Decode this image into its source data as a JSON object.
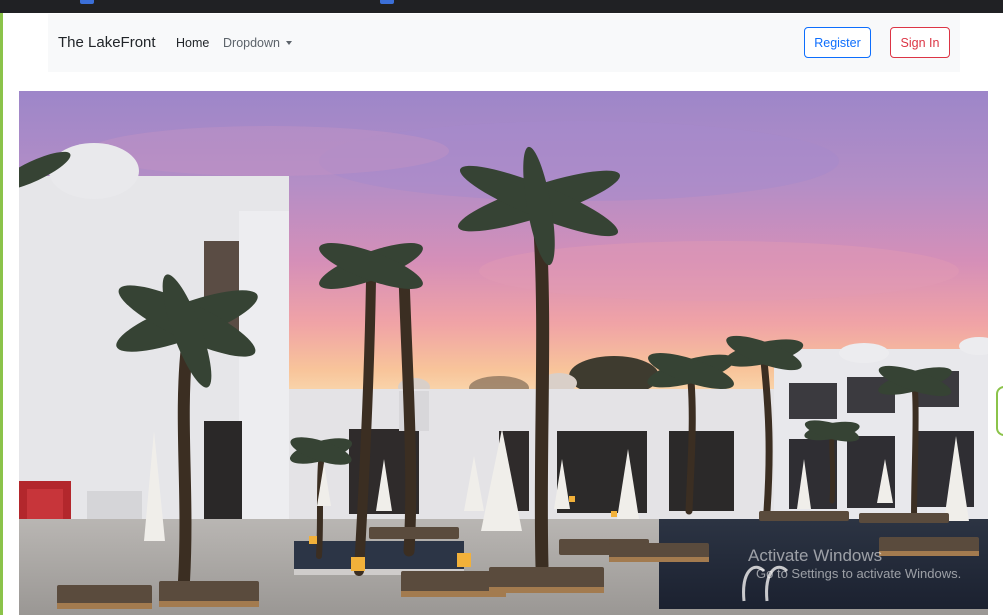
{
  "navbar": {
    "brand": "The LakeFront",
    "links": [
      {
        "label": "Home"
      },
      {
        "label": "Dropdown"
      }
    ],
    "register_label": "Register",
    "signin_label": "Sign In"
  },
  "colors": {
    "register_border": "#0d6efd",
    "signin_border": "#dc3545",
    "navbar_bg": "#f8f9fa"
  },
  "watermark": {
    "title": "Activate Windows",
    "subtitle": "Go to Settings to activate Windows."
  }
}
